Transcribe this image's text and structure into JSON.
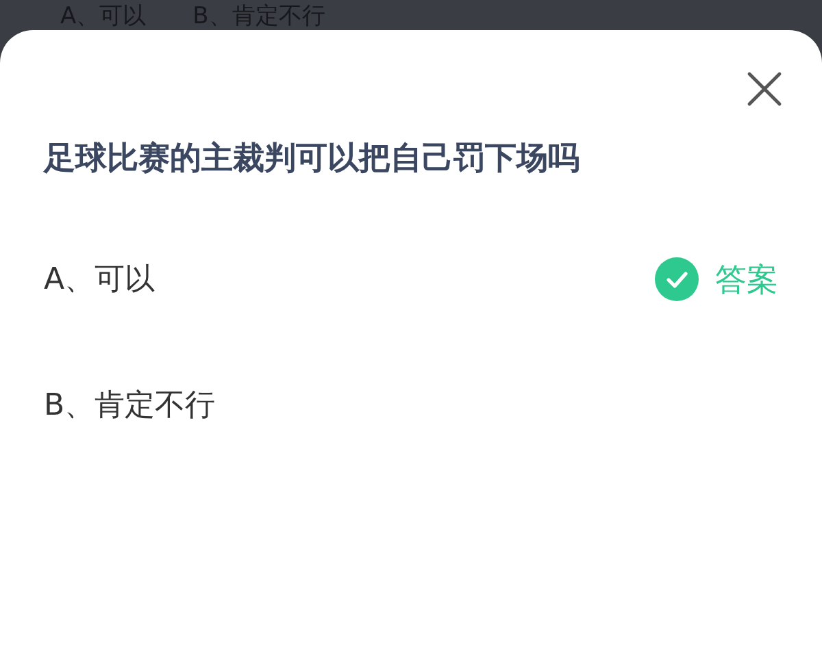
{
  "backdrop": {
    "options": [
      "A、可以",
      "B、肯定不行"
    ]
  },
  "sheet": {
    "question": "足球比赛的主裁判可以把自己罚下场吗",
    "options": [
      {
        "label": "A、可以",
        "correct": true,
        "answer_label": "答案"
      },
      {
        "label": "B、肯定不行",
        "correct": false
      }
    ]
  }
}
